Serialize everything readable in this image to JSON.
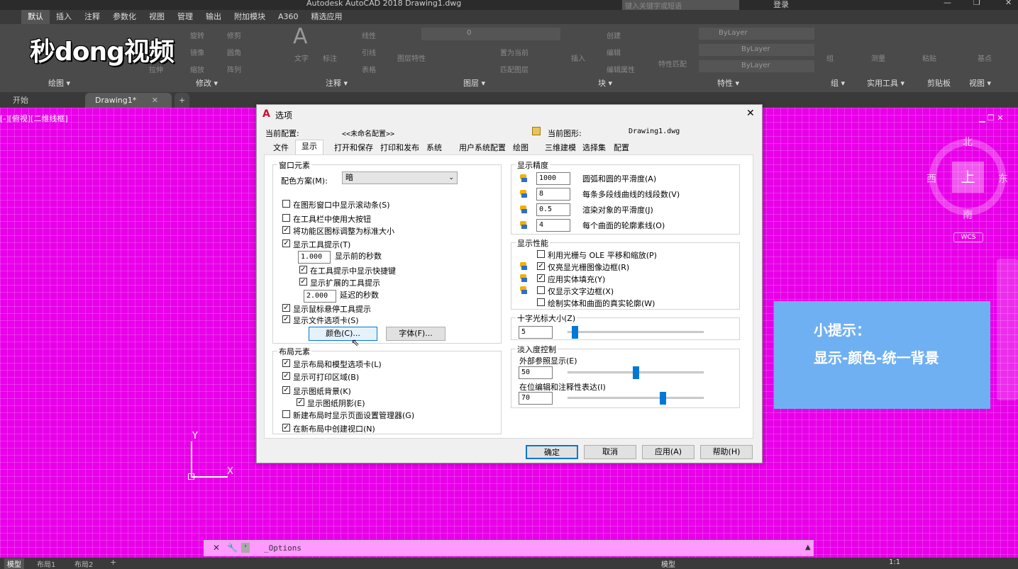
{
  "window": {
    "title": "Autodesk AutoCAD 2018   Drawing1.dwg",
    "search_placeholder": "键入关键字或短语",
    "login": "登录"
  },
  "watermark": "秒dong视频",
  "ribbon_tabs": [
    "默认",
    "插入",
    "注释",
    "参数化",
    "视图",
    "管理",
    "输出",
    "附加模块",
    "A360",
    "精选应用"
  ],
  "ribbon_panels": [
    "绘图 ▾",
    "修改 ▾",
    "注释 ▾",
    "图层 ▾",
    "块 ▾",
    "特性 ▾",
    "组 ▾",
    "实用工具 ▾",
    "剪贴板",
    "视图 ▾"
  ],
  "ribbon_ghost": {
    "modify1": "移动",
    "modify2": "旋转",
    "modify3": "修剪",
    "modify4": "复制",
    "modify5": "镜像",
    "modify6": "圆角",
    "modify7": "拉伸",
    "modify8": "缩放",
    "modify9": "阵列",
    "text": "文字",
    "dim": "标注",
    "linear": "线性",
    "leader": "引线",
    "table": "表格",
    "layerprop": "图层特性",
    "setcur": "置为当前",
    "matchlayer": "匹配图层",
    "insert": "插入",
    "create": "创建",
    "edit": "编辑",
    "editattr": "编辑属性",
    "matchprop": "特性匹配",
    "bylayer": "ByLayer",
    "group": "组",
    "measure": "测量",
    "paste": "粘贴",
    "base": "基点",
    "layer_state": "0"
  },
  "doc_tabs": {
    "start": "开始",
    "drawing": "Drawing1*"
  },
  "viewport_label": "[-][俯视][二维线框]",
  "viewcube": {
    "top": "上",
    "north": "北",
    "south": "南",
    "east": "东",
    "west": "西",
    "wcs": "WCS"
  },
  "ucs": {
    "x": "X",
    "y": "Y"
  },
  "tip": {
    "title": "小提示：",
    "body": "显示-颜色-统一背景"
  },
  "command": {
    "text": "_Options"
  },
  "status": {
    "model_tab": "模型",
    "layout1": "布局1",
    "layout2": "布局2",
    "model": "模型",
    "scale": "1:1"
  },
  "dialog": {
    "title": "选项",
    "current_profile_label": "当前配置:",
    "current_profile": "<<未命名配置>>",
    "current_drawing_label": "当前图形:",
    "current_drawing": "Drawing1.dwg",
    "tabs": [
      "文件",
      "显示",
      "打开和保存",
      "打印和发布",
      "系统",
      "用户系统配置",
      "绘图",
      "三维建模",
      "选择集",
      "配置"
    ],
    "window_elements": {
      "title": "窗口元素",
      "scheme_label": "配色方案(M):",
      "scheme_value": "暗",
      "checks": [
        {
          "label": "在图形窗口中显示滚动条(S)",
          "checked": false
        },
        {
          "label": "在工具栏中使用大按钮",
          "checked": false
        },
        {
          "label": "将功能区图标调整为标准大小",
          "checked": true
        },
        {
          "label": "显示工具提示(T)",
          "checked": true
        }
      ],
      "delay_value": "1.000",
      "delay_label": "显示前的秒数",
      "show_shortcut": {
        "label": "在工具提示中显示快捷键",
        "checked": true
      },
      "show_extended": {
        "label": "显示扩展的工具提示",
        "checked": true
      },
      "ext_delay_value": "2.000",
      "ext_delay_label": "延迟的秒数",
      "rollover": {
        "label": "显示鼠标悬停工具提示",
        "checked": true
      },
      "file_tabs": {
        "label": "显示文件选项卡(S)",
        "checked": true
      },
      "colors_button": "颜色(C)...",
      "fonts_button": "字体(F)..."
    },
    "layout_elements": {
      "title": "布局元素",
      "checks": [
        {
          "label": "显示布局和模型选项卡(L)",
          "checked": true
        },
        {
          "label": "显示可打印区域(B)",
          "checked": true
        },
        {
          "label": "显示图纸背景(K)",
          "checked": true
        }
      ],
      "shadow": {
        "label": "显示图纸阴影(E)",
        "checked": true
      },
      "checks2": [
        {
          "label": "新建布局时显示页面设置管理器(G)",
          "checked": false
        },
        {
          "label": "在新布局中创建视口(N)",
          "checked": true
        }
      ]
    },
    "resolution": {
      "title": "显示精度",
      "rows": [
        {
          "value": "1000",
          "label": "圆弧和圆的平滑度(A)"
        },
        {
          "value": "8",
          "label": "每条多段线曲线的线段数(V)"
        },
        {
          "value": "0.5",
          "label": "渲染对象的平滑度(J)"
        },
        {
          "value": "4",
          "label": "每个曲面的轮廓素线(O)"
        }
      ]
    },
    "performance": {
      "title": "显示性能",
      "checks": [
        {
          "label": "利用光栅与 OLE 平移和缩放(P)",
          "checked": false
        },
        {
          "label": "仅亮显光栅图像边框(R)",
          "checked": true
        },
        {
          "label": "应用实体填充(Y)",
          "checked": true
        },
        {
          "label": "仅显示文字边框(X)",
          "checked": false
        },
        {
          "label": "绘制实体和曲面的真实轮廓(W)",
          "checked": false
        }
      ]
    },
    "crosshair": {
      "title": "十字光标大小(Z)",
      "value": "5",
      "fraction": 0.05
    },
    "fade": {
      "title": "淡入度控制",
      "xref_label": "外部参照显示(E)",
      "xref_value": "50",
      "xref_fraction": 0.5,
      "inplace_label": "在位编辑和注释性表达(I)",
      "inplace_value": "70",
      "inplace_fraction": 0.7
    },
    "buttons": {
      "ok": "确定",
      "cancel": "取消",
      "apply": "应用(A)",
      "help": "帮助(H)"
    }
  }
}
